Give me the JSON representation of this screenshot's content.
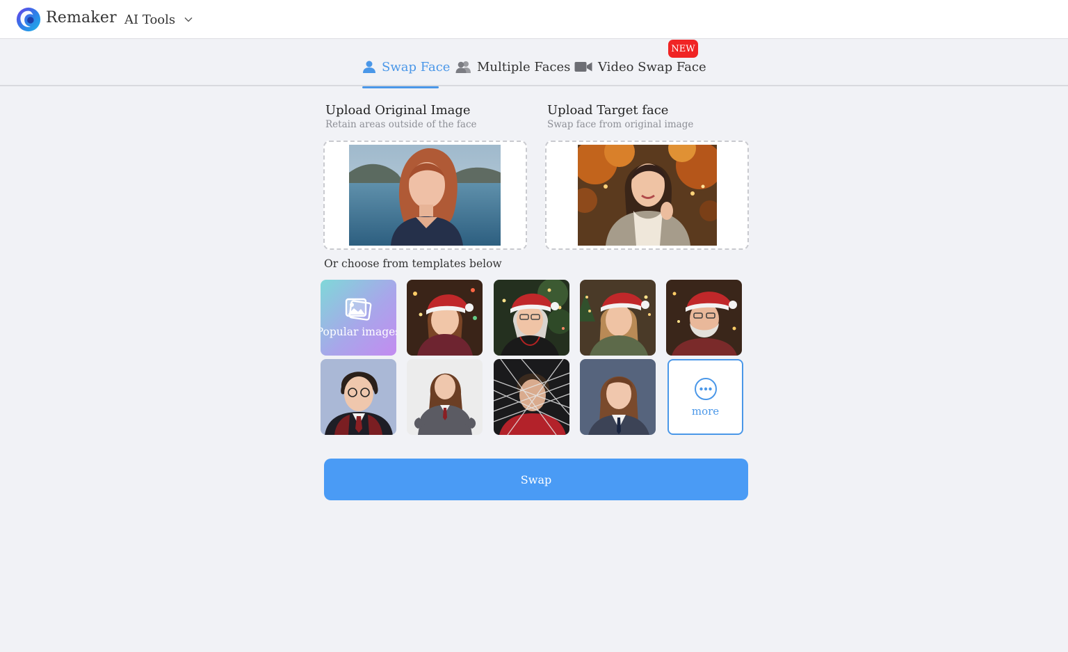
{
  "header": {
    "brand": "Remaker",
    "tools_menu_label": "AI Tools"
  },
  "tabs": {
    "swap_face": "Swap Face",
    "multiple_faces": "Multiple Faces",
    "video_swap_face": "Video Swap Face",
    "new_badge": "NEW",
    "active": "Swap Face"
  },
  "upload_original": {
    "title": "Upload Original Image",
    "subtitle": "Retain areas outside of the face"
  },
  "upload_target": {
    "title": "Upload Target face",
    "subtitle": "Swap face from original image"
  },
  "templates": {
    "label": "Or choose from templates below",
    "popular_label": "Popular images",
    "more_label": "more"
  },
  "actions": {
    "swap_label": "Swap"
  },
  "colors": {
    "accent": "#4a97e8",
    "swap_button": "#4a9bf5",
    "new_badge": "#f02424",
    "background": "#f1f2f6"
  }
}
